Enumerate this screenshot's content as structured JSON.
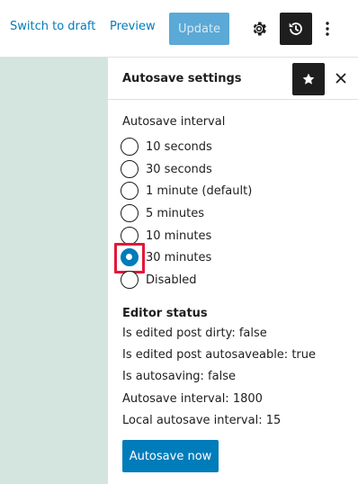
{
  "toolbar": {
    "switch_to_draft": "Switch to draft",
    "preview": "Preview",
    "update": "Update",
    "icons": [
      "gear-icon",
      "history-icon",
      "more-vertical-icon"
    ]
  },
  "sidebar": {
    "title": "Autosave settings",
    "autosave_interval_label": "Autosave interval",
    "options": [
      {
        "label": "10 seconds",
        "checked": false
      },
      {
        "label": "30 seconds",
        "checked": false
      },
      {
        "label": "1 minute (default)",
        "checked": false
      },
      {
        "label": "5 minutes",
        "checked": false
      },
      {
        "label": "10 minutes",
        "checked": false
      },
      {
        "label": "30 minutes",
        "checked": true
      },
      {
        "label": "Disabled",
        "checked": false
      }
    ],
    "editor_status_title": "Editor status",
    "status": [
      "Is edited post dirty: false",
      "Is edited post autosaveable: true",
      "Is autosaving: false",
      "Autosave interval: 1800",
      "Local autosave interval: 15"
    ],
    "autosave_now": "Autosave now"
  },
  "colors": {
    "accent": "#007cba",
    "canvas": "#d4e4de",
    "highlight": "#e2183a"
  }
}
